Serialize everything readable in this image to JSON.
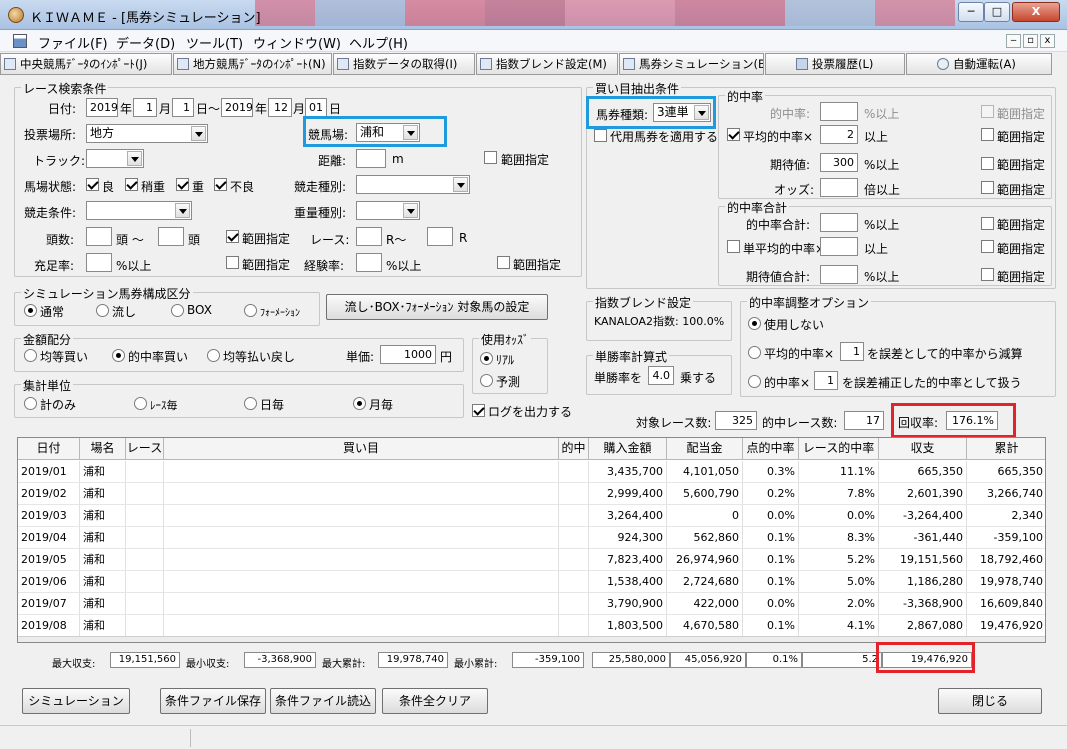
{
  "window": {
    "title": "ＫＩＷＡＭＥ - [馬券シミュレーション]",
    "minimize": "─",
    "maximize": "□",
    "close": "X"
  },
  "menu": [
    "ファイル(F)",
    "データ(D)",
    "ツール(T)",
    "ウィンドウ(W)",
    "ヘルプ(H)"
  ],
  "mdi": {
    "minimize": "‒",
    "restore": "▫",
    "close": "x"
  },
  "toolbar": [
    "中央競馬ﾃﾞｰﾀのｲﾝﾎﾟｰﾄ(J)",
    "地方競馬ﾃﾞｰﾀのｲﾝﾎﾟｰﾄ(N)",
    "指数データの取得(I)",
    "指数ブレンド設定(M)",
    "馬券シミュレーション(B)",
    "投票履歴(L)",
    "自動運転(A)"
  ],
  "race_search": {
    "title": "レース検索条件",
    "date_label": "日付:",
    "start": {
      "year": "2019",
      "month": "1",
      "day": "1"
    },
    "end": {
      "year": "2019",
      "month": "12",
      "day": "01"
    },
    "u_year": "年",
    "u_month": "月",
    "u_day_tilde": "日～",
    "u_day": "日",
    "venue_label": "投票場所:",
    "venue": "地方",
    "track_name_label": "競馬場:",
    "track_name": "浦和",
    "track_label": "トラック:",
    "track": "",
    "distance_label": "距離:",
    "distance": "",
    "distance_unit": "m",
    "range_label": "範囲指定",
    "condition_label": "馬場状態:",
    "conditions": [
      {
        "label": "良",
        "checked": true
      },
      {
        "label": "稍重",
        "checked": true
      },
      {
        "label": "重",
        "checked": true
      },
      {
        "label": "不良",
        "checked": true
      }
    ],
    "race_type_label": "競走種別:",
    "race_type": "",
    "race_cond_label": "競走条件:",
    "race_cond": "",
    "weight_label": "重量種別:",
    "weight": "",
    "heads_label": "頭数:",
    "heads_from": "",
    "heads_to": "",
    "heads_unit_tilde": "頭 ～",
    "heads_unit": "頭",
    "race_no_label": "レース:",
    "race_from": "",
    "race_to": "",
    "race_unit_tilde": "R～",
    "race_unit": "R",
    "fill_label": "充足率:",
    "fill": "",
    "fill_unit": "%以上",
    "exp_label": "経験率:",
    "exp": "",
    "exp_unit": "%以上"
  },
  "ticket_structure": {
    "title": "シミュレーション馬券構成区分",
    "options": [
      {
        "label": "通常",
        "selected": true
      },
      {
        "label": "流し",
        "selected": false
      },
      {
        "label": "BOX",
        "selected": false
      },
      {
        "label": "ﾌｫｰﾒｰｼｮﾝ",
        "selected": false
      }
    ],
    "target_button": "流し･BOX･ﾌｫｰﾒｰｼｮﾝ 対象馬の設定"
  },
  "allocation": {
    "title": "金額配分",
    "options": [
      {
        "label": "均等買い",
        "selected": false
      },
      {
        "label": "的中率買い",
        "selected": true
      },
      {
        "label": "均等払い戻し",
        "selected": false
      }
    ],
    "unit_label": "単価:",
    "unit_value": "1000",
    "unit_currency": "円"
  },
  "odds": {
    "title": "使用ｵｯｽﾞ",
    "options": [
      {
        "label": "ﾘｱﾙ",
        "selected": true
      },
      {
        "label": "予測",
        "selected": false
      }
    ]
  },
  "aggregation": {
    "title": "集計単位",
    "options": [
      {
        "label": "計のみ",
        "selected": false
      },
      {
        "label": "ﾚｰｽ毎",
        "selected": false
      },
      {
        "label": "日毎",
        "selected": false
      },
      {
        "label": "月毎",
        "selected": true
      }
    ]
  },
  "log_output": {
    "label": "ログを出力する",
    "checked": true
  },
  "extraction": {
    "title": "買い目抽出条件",
    "ticket_type_label": "馬券種類:",
    "ticket_type": "3連単",
    "substitute_label": "代用馬券を適用する",
    "substitute_checked": false
  },
  "hit_rate": {
    "title": "的中率",
    "hit_label": "的中率:",
    "hit_value": "",
    "hit_unit": "%以上",
    "avg_label": "平均的中率×",
    "avg_checked": true,
    "avg_value": "2",
    "avg_unit": "以上",
    "ev_label": "期待値:",
    "ev_value": "300",
    "ev_unit": "%以上",
    "odds_label": "オッズ:",
    "odds_value": "",
    "odds_unit": "倍以上",
    "range_label": "範囲指定"
  },
  "hit_total": {
    "title": "的中率合計",
    "total_label": "的中率合計:",
    "total_value": "",
    "total_unit": "%以上",
    "single_label": "単平均的中率×",
    "single_checked": false,
    "single_value": "",
    "single_unit": "以上",
    "ev_total_label": "期待値合計:",
    "ev_total_value": "",
    "ev_total_unit": "%以上",
    "range_label": "範囲指定"
  },
  "blend": {
    "title": "指数ブレンド設定",
    "text": "KANALOA2指数: 100.0%"
  },
  "win_rate": {
    "title": "単勝率計算式",
    "label": "単勝率を",
    "value": "4.0",
    "suffix": "乗する"
  },
  "adjust": {
    "title": "的中率調整オプション",
    "none_label": "使用しない",
    "opt1_prefix": "平均的中率×",
    "opt1_value": "1",
    "opt1_suffix": "を誤差として的中率から減算",
    "opt2_prefix": "的中率×",
    "opt2_value": "1",
    "opt2_suffix": "を誤差補正した的中率として扱う",
    "selected": "none"
  },
  "summary": {
    "races_label": "対象レース数:",
    "races": "325",
    "hits_label": "的中レース数:",
    "hits": "17",
    "recovery_label": "回収率:",
    "recovery": "176.1%"
  },
  "table": {
    "headers": [
      "日付",
      "場名",
      "レース",
      "買い目",
      "的中",
      "購入金額",
      "配当金",
      "点的中率",
      "レース的中率",
      "収支",
      "累計"
    ],
    "rows": [
      [
        "2019/01",
        "浦和",
        "",
        "",
        "",
        "3,435,700",
        "4,101,050",
        "0.3%",
        "11.1%",
        "665,350",
        "665,350"
      ],
      [
        "2019/02",
        "浦和",
        "",
        "",
        "",
        "2,999,400",
        "5,600,790",
        "0.2%",
        "7.8%",
        "2,601,390",
        "3,266,740"
      ],
      [
        "2019/03",
        "浦和",
        "",
        "",
        "",
        "3,264,400",
        "0",
        "0.0%",
        "0.0%",
        "-3,264,400",
        "2,340"
      ],
      [
        "2019/04",
        "浦和",
        "",
        "",
        "",
        "924,300",
        "562,860",
        "0.1%",
        "8.3%",
        "-361,440",
        "-359,100"
      ],
      [
        "2019/05",
        "浦和",
        "",
        "",
        "",
        "7,823,400",
        "26,974,960",
        "0.1%",
        "5.2%",
        "19,151,560",
        "18,792,460"
      ],
      [
        "2019/06",
        "浦和",
        "",
        "",
        "",
        "1,538,400",
        "2,724,680",
        "0.1%",
        "5.0%",
        "1,186,280",
        "19,978,740"
      ],
      [
        "2019/07",
        "浦和",
        "",
        "",
        "",
        "3,790,900",
        "422,000",
        "0.0%",
        "2.0%",
        "-3,368,900",
        "16,609,840"
      ],
      [
        "2019/08",
        "浦和",
        "",
        "",
        "",
        "1,803,500",
        "4,670,580",
        "0.1%",
        "4.1%",
        "2,867,080",
        "19,476,920"
      ]
    ]
  },
  "footer": {
    "max_profit_label": "最大収支:",
    "max_profit": "19,151,560",
    "min_profit_label": "最小収支:",
    "min_profit": "-3,368,900",
    "max_cum_label": "最大累計:",
    "max_cum": "19,978,740",
    "min_cum_label": "最小累計:",
    "min_cum": "-359,100",
    "purchase": "25,580,000",
    "payout": "45,056,920",
    "point_rate": "0.1%",
    "race_rate": "5.2",
    "total": "19,476,920"
  },
  "buttons": {
    "simulate": "シミュレーション",
    "save": "条件ファイル保存",
    "load": "条件ファイル読込",
    "clear": "条件全クリア",
    "close": "閉じる"
  },
  "colors": {
    "highlight_blue": "#1e9bdc",
    "highlight_red": "#e3232a"
  }
}
